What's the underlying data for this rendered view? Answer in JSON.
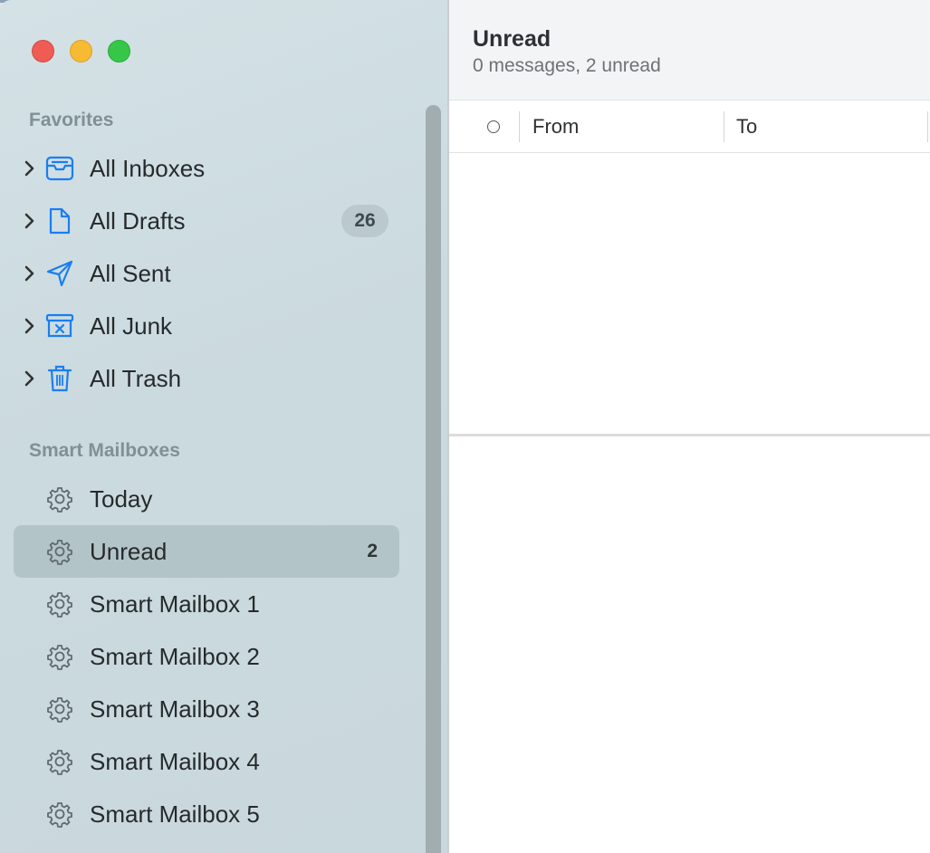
{
  "window": {
    "traffic_lights": {
      "close": "#ee5c54",
      "minimize": "#f6bb33",
      "maximize": "#36c748"
    }
  },
  "sidebar": {
    "favorites_title": "Favorites",
    "favorites": [
      {
        "label": "All Inboxes",
        "icon": "inbox-tray-icon",
        "badge": null
      },
      {
        "label": "All Drafts",
        "icon": "document-icon",
        "badge": "26"
      },
      {
        "label": "All Sent",
        "icon": "paper-plane-icon",
        "badge": null
      },
      {
        "label": "All Junk",
        "icon": "junk-box-icon",
        "badge": null
      },
      {
        "label": "All Trash",
        "icon": "trash-icon",
        "badge": null
      }
    ],
    "smart_title": "Smart Mailboxes",
    "smart": [
      {
        "label": "Today",
        "icon": "gear-icon",
        "count": null
      },
      {
        "label": "Unread",
        "icon": "gear-icon",
        "count": "2",
        "selected": true
      },
      {
        "label": "Smart Mailbox 1",
        "icon": "gear-icon",
        "count": null
      },
      {
        "label": "Smart Mailbox 2",
        "icon": "gear-icon",
        "count": null
      },
      {
        "label": "Smart Mailbox 3",
        "icon": "gear-icon",
        "count": null
      },
      {
        "label": "Smart Mailbox 4",
        "icon": "gear-icon",
        "count": null
      },
      {
        "label": "Smart Mailbox 5",
        "icon": "gear-icon",
        "count": null
      }
    ],
    "accent_color": "#1a7ef2"
  },
  "main": {
    "title": "Unread",
    "subtitle": "0 messages, 2 unread",
    "columns": {
      "from": "From",
      "to": "To"
    }
  }
}
